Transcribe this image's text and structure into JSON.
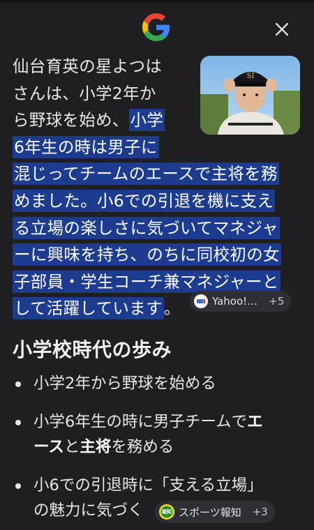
{
  "overview": {
    "lines": [
      [
        "仙台育英の星よつは",
        ""
      ],
      [
        "さんは、小学2年か",
        ""
      ],
      [
        "ら野球を始め、",
        "小学"
      ],
      [
        "",
        "6年生の時は男子に"
      ],
      [
        "",
        "混じってチームのエースで主将を務"
      ],
      [
        "",
        "めました。小6での引退を機に支え"
      ],
      [
        "",
        "る立場の楽しさに気づいてマネジャ"
      ],
      [
        "",
        "ーに興味を持ち、のちに同校初の女"
      ],
      [
        "",
        "子部員・学生コーチ兼マネジャーと"
      ],
      [
        "",
        "して活躍しています"
      ]
    ],
    "end_mark": "。",
    "source_chip": {
      "label": "Yahoo!…",
      "count": "+5",
      "icon": "yahoo-favicon"
    }
  },
  "section": {
    "heading": "小学校時代の歩み",
    "bullets": [
      {
        "lines": [
          [
            "小学2年から野球を始める",
            false
          ]
        ]
      },
      {
        "lines": [
          [
            "小学6年生の時に男子チームで",
            false
          ],
          [
            "エ",
            true
          ],
          [
            "ース",
            true
          ],
          [
            "と",
            false
          ],
          [
            "主将",
            true
          ],
          [
            "を務める",
            false
          ]
        ]
      },
      {
        "lines": [
          [
            "小6での引退時に「支える立場」",
            false
          ],
          [
            "の魅力に気づく",
            false
          ]
        ]
      }
    ],
    "source_chip": {
      "label": "スポーツ報知",
      "count": "+3",
      "icon": "hochi-favicon",
      "icon_text": "報知"
    }
  },
  "colors": {
    "background": "#1f1f22",
    "highlight": "#1d3c8f",
    "chip": "#2e2f33"
  }
}
